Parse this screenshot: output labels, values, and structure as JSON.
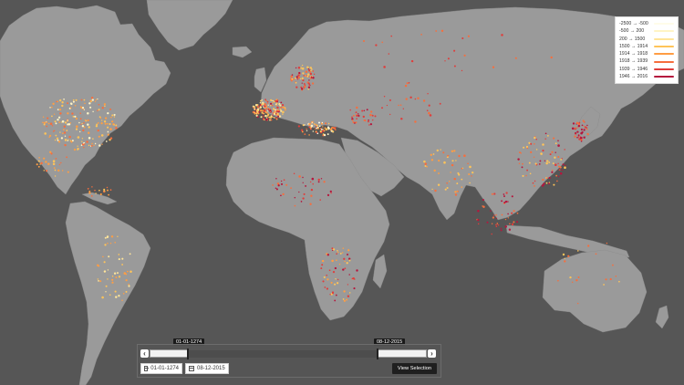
{
  "legend": {
    "items": [
      {
        "label": "-2500 → -500",
        "color": "#fffce9"
      },
      {
        "label": "-500 → 200",
        "color": "#fff4c5"
      },
      {
        "label": "200 → 1500",
        "color": "#ffe59a"
      },
      {
        "label": "1500 → 1914",
        "color": "#ffc459"
      },
      {
        "label": "1914 → 1918",
        "color": "#ff9d43"
      },
      {
        "label": "1918 → 1939",
        "color": "#f66e3d"
      },
      {
        "label": "1939 → 1946",
        "color": "#df3e3c"
      },
      {
        "label": "1946 → 2016",
        "color": "#b5163d"
      }
    ]
  },
  "timeline": {
    "prev_icon": "‹",
    "next_icon": "›",
    "start_tooltip": "01-01-1274",
    "end_tooltip": "08-12-2015",
    "start_date": "01-01-1274",
    "end_date": "08-12-2015",
    "view_button": "View Selection"
  },
  "colors": {
    "ocean": "#565656",
    "land": "#9a9a9a",
    "panel": "#555555"
  }
}
